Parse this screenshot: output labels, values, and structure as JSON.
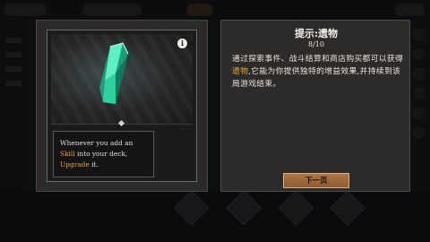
{
  "hint": {
    "title": "提示:遗物",
    "page": "8/10",
    "body_before": "通过探索事件、战斗结算和商店购买都可以获得",
    "body_keyword": "遗物",
    "body_after": ",它能为你提供独特的增益效果,并持续到该局游戏结束。",
    "next_button": "下一页"
  },
  "card": {
    "info_icon_label": "i",
    "desc_part1": "Whenever you add an ",
    "desc_kw1": "Skill",
    "desc_part2": " into your deck, ",
    "desc_kw2": "Upgrade",
    "desc_part3": " it.",
    "art_icon": "teal-crystal-relic-icon"
  },
  "colors": {
    "keyword": "#e6a33c",
    "button": "#9a6539",
    "crystal": "#2fd0a0"
  }
}
